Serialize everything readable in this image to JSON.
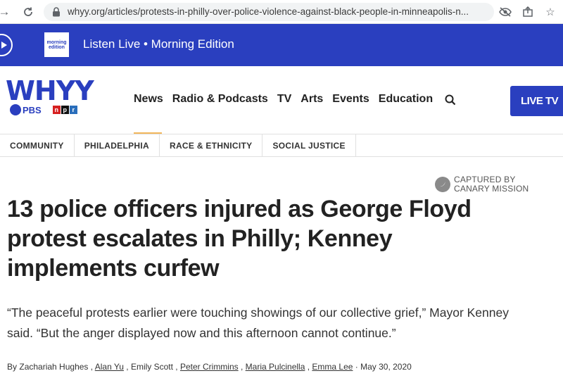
{
  "browser": {
    "url": "whyy.org/articles/protests-in-philly-over-police-violence-against-black-people-in-minneapolis-n..."
  },
  "listen_bar": {
    "thumb_text": "morning edition",
    "label": "Listen Live • Morning Edition"
  },
  "header": {
    "logo": "WHYY",
    "pbs": "PBS",
    "npr_letters": [
      "n",
      "p",
      "r"
    ],
    "npr_colors": [
      "#d62021",
      "#111111",
      "#2a6ebb"
    ],
    "nav": [
      "News",
      "Radio & Podcasts",
      "TV",
      "Arts",
      "Events",
      "Education"
    ],
    "live_tv": "LIVE TV"
  },
  "topics": [
    "COMMUNITY",
    "PHILADELPHIA",
    "RACE & ETHNICITY",
    "SOCIAL JUSTICE"
  ],
  "article": {
    "captured_line1": "CAPTURED BY",
    "captured_line2": "CANARY MISSION",
    "headline": "13 police officers injured as George Floyd protest escalates in Philly; Kenney implements curfew",
    "dek": "“The peaceful protests earlier were touching showings of our collective grief,” Mayor Kenney said. “But the anger displayed now and this afternoon cannot continue.”",
    "byline": {
      "prefix": "By",
      "authors": [
        "Zachariah Hughes",
        "Alan Yu",
        "Emily Scott",
        "Peter Crimmins",
        "Maria Pulcinella",
        "Emma Lee"
      ],
      "date": "May 30, 2020"
    }
  },
  "colors": {
    "brand_blue": "#2a3fbf",
    "accent": "#f2b75b"
  }
}
